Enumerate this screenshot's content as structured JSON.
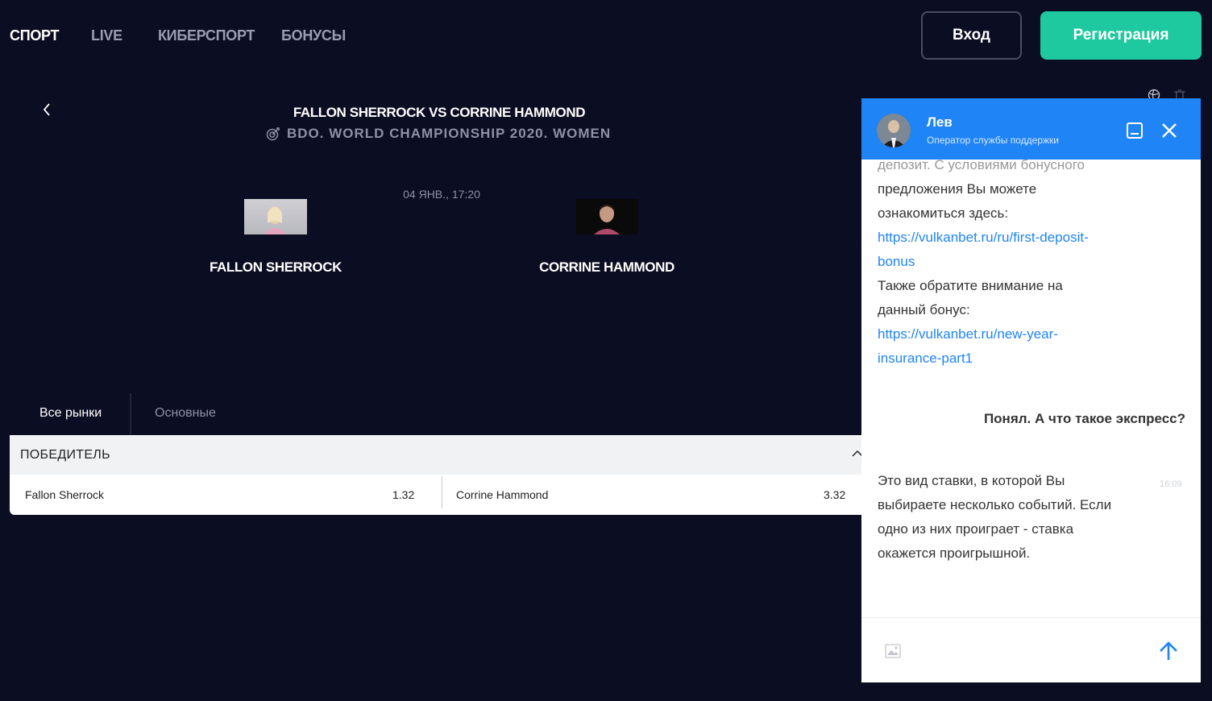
{
  "nav": {
    "items": [
      {
        "label": "СПОРТ"
      },
      {
        "label": "LIVE"
      },
      {
        "label": "КИБЕРСПОРТ"
      },
      {
        "label": "БОНУСЫ"
      }
    ],
    "login_label": "Вход",
    "register_label": "Регистрация"
  },
  "event": {
    "title": "FALLON SHERROCK VS CORRINE HAMMOND",
    "tournament": "BDO. WORLD CHAMPIONSHIP 2020. WOMEN",
    "date": "04 ЯНВ., 17:20",
    "player1": "FALLON SHERROCK",
    "player2": "CORRINE HAMMOND"
  },
  "markets": {
    "tabs": [
      {
        "label": "Все рынки"
      },
      {
        "label": "Основные"
      }
    ],
    "winner": {
      "title": "ПОБЕДИТЕЛЬ",
      "outcomes": [
        {
          "name": "Fallon Sherrock",
          "odd": "1.32"
        },
        {
          "name": "Corrine Hammond",
          "odd": "3.32"
        }
      ]
    }
  },
  "chat": {
    "operator_name": "Лев",
    "operator_role": "Оператор службы поддержки",
    "messages": {
      "faded_line": "депозит. С условиями бонусного",
      "line1": "предложения Вы можете",
      "line2": "ознакомиться здесь:",
      "link1_a": "https://vulkanbet.ru/ru/first-deposit-",
      "link1_b": "bonus",
      "line3": "Также обратите внимание  на",
      "line4": "данный бонус:",
      "link2_a": "https://vulkanbet.ru/new-year-",
      "link2_b": "insurance-part1",
      "user_msg": "Понял. А что такое экспресс?",
      "reply1": "Это вид ставки, в которой Вы",
      "reply2": "выбираете несколько событий. Если",
      "reply3": "одно из них проиграет - ставка",
      "reply4": "окажется проигрышной.",
      "time": "16:09"
    }
  },
  "colors": {
    "background": "#0b0d22",
    "accent": "#1ec99f",
    "chat_blue": "#1f84f5"
  }
}
